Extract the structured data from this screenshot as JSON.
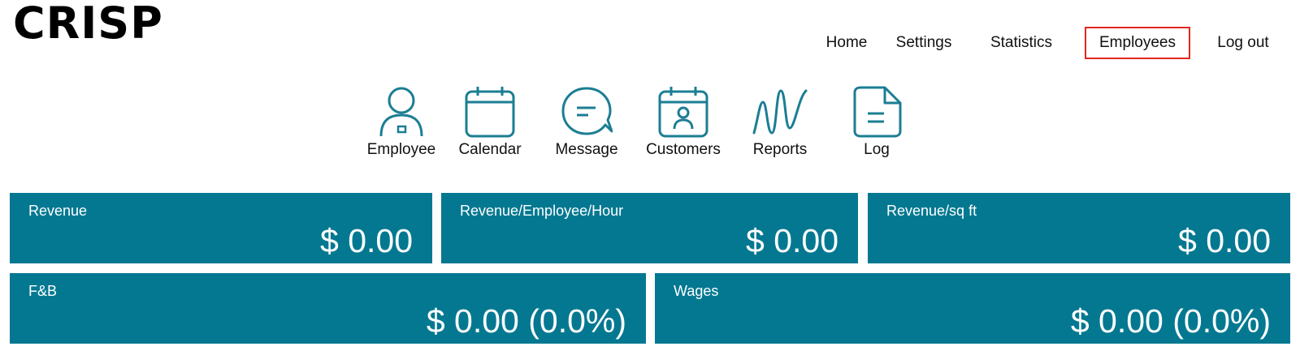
{
  "logo": "CRISP",
  "nav": [
    "Home",
    "Settings",
    "Statistics",
    "Employees",
    "Log out"
  ],
  "nav_active": "Employees",
  "quick_links": [
    {
      "label": "Employee",
      "icon": "person-badge-icon"
    },
    {
      "label": "Calendar",
      "icon": "calendar-icon"
    },
    {
      "label": "Message",
      "icon": "chat-bubble-icon"
    },
    {
      "label": "Customers",
      "icon": "calendar-person-icon"
    },
    {
      "label": "Reports",
      "icon": "wave-chart-icon"
    },
    {
      "label": "Log",
      "icon": "document-icon"
    }
  ],
  "cards": [
    {
      "title": "Revenue",
      "value": "$ 0.00"
    },
    {
      "title": "Revenue/Employee/Hour",
      "value": "$ 0.00"
    },
    {
      "title": "Revenue/sq ft",
      "value": "$ 0.00"
    },
    {
      "title": "F&B",
      "value": "$ 0.00 (0.0%)"
    },
    {
      "title": "Wages",
      "value": "$ 0.00 (0.0%)"
    }
  ],
  "colors": {
    "accent": "#047891",
    "active_border": "#e0281e",
    "icon": "#1b7e93"
  }
}
